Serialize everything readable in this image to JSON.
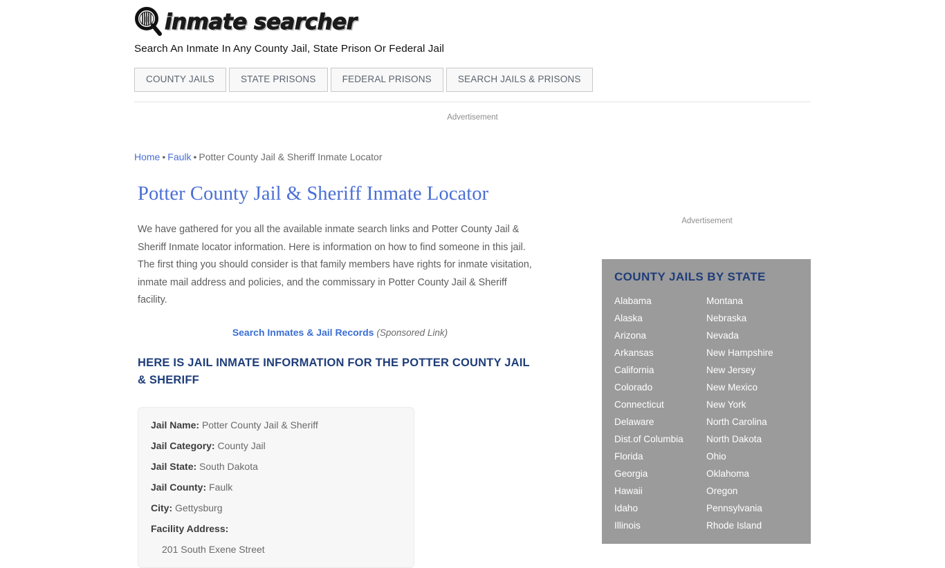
{
  "header": {
    "logo_icon": "magnifier-prison-bars-icon",
    "logo_text": "inmate searcher",
    "tagline": "Search An Inmate In Any County Jail, State Prison Or Federal Jail"
  },
  "nav": {
    "items": [
      {
        "label": "COUNTY JAILS"
      },
      {
        "label": "STATE PRISONS"
      },
      {
        "label": "FEDERAL PRISONS"
      },
      {
        "label": "SEARCH JAILS & PRISONS"
      }
    ]
  },
  "ads": {
    "top_label": "Advertisement",
    "right_label": "Advertisement"
  },
  "breadcrumb": {
    "home": "Home",
    "county": "Faulk",
    "current": "Potter County Jail & Sheriff Inmate Locator",
    "separator": "•"
  },
  "main": {
    "title": "Potter County Jail & Sheriff Inmate Locator",
    "intro": "We have gathered for you all the available inmate search links and Potter County Jail & Sheriff Inmate locator information. Here is information on how to find someone in this jail. The first thing you should consider is that family members have rights for inmate visitation, inmate mail address and policies, and the commissary in Potter County Jail & Sheriff facility.",
    "sponsored_link": "Search Inmates & Jail Records",
    "sponsored_note": "(Sponsored Link)",
    "section_heading": "HERE IS JAIL INMATE INFORMATION FOR THE POTTER COUNTY JAIL & SHERIFF"
  },
  "info_box": {
    "rows": [
      {
        "label": "Jail Name:",
        "value": "Potter County Jail & Sheriff"
      },
      {
        "label": "Jail Category:",
        "value": "County Jail"
      },
      {
        "label": "Jail State:",
        "value": "South Dakota"
      },
      {
        "label": "Jail County:",
        "value": "Faulk"
      },
      {
        "label": "City:",
        "value": "Gettysburg"
      }
    ],
    "address_label": "Facility Address:",
    "address_line1": "201 South Exene Street"
  },
  "sidebar": {
    "title": "COUNTY JAILS BY STATE",
    "column_left": [
      "Alabama",
      "Alaska",
      "Arizona",
      "Arkansas",
      "California",
      "Colorado",
      "Connecticut",
      "Delaware",
      "Dist.of Columbia",
      "Florida",
      "Georgia",
      "Hawaii",
      "Idaho",
      "Illinois"
    ],
    "column_right": [
      "Montana",
      "Nebraska",
      "Nevada",
      "New Hampshire",
      "New Jersey",
      "New Mexico",
      "New York",
      "North Carolina",
      "North Dakota",
      "Ohio",
      "Oklahoma",
      "Oregon",
      "Pennsylvania",
      "Rhode Island"
    ]
  },
  "colors": {
    "link_blue": "#4a6fd4",
    "heading_navy": "#1f3d7a",
    "sidebar_gray": "#9b9b9b",
    "body_text": "#5d5d5d"
  }
}
